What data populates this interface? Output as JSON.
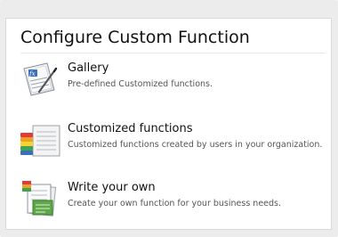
{
  "dialog": {
    "title": "Configure Custom Function"
  },
  "options": [
    {
      "label": "Gallery",
      "description": "Pre-defined Customized functions.",
      "icon": "function-gallery-icon"
    },
    {
      "label": "Customized functions",
      "description": "Customized functions created by users in your organization.",
      "icon": "stacked-documents-icon"
    },
    {
      "label": "Write your own",
      "description": "Create your own function for your business needs.",
      "icon": "write-document-icon"
    }
  ],
  "colors": {
    "background": "#ececec",
    "panel": "#ffffff",
    "border": "#d9d9d9",
    "text": "#111111",
    "muted_text": "#555555"
  }
}
